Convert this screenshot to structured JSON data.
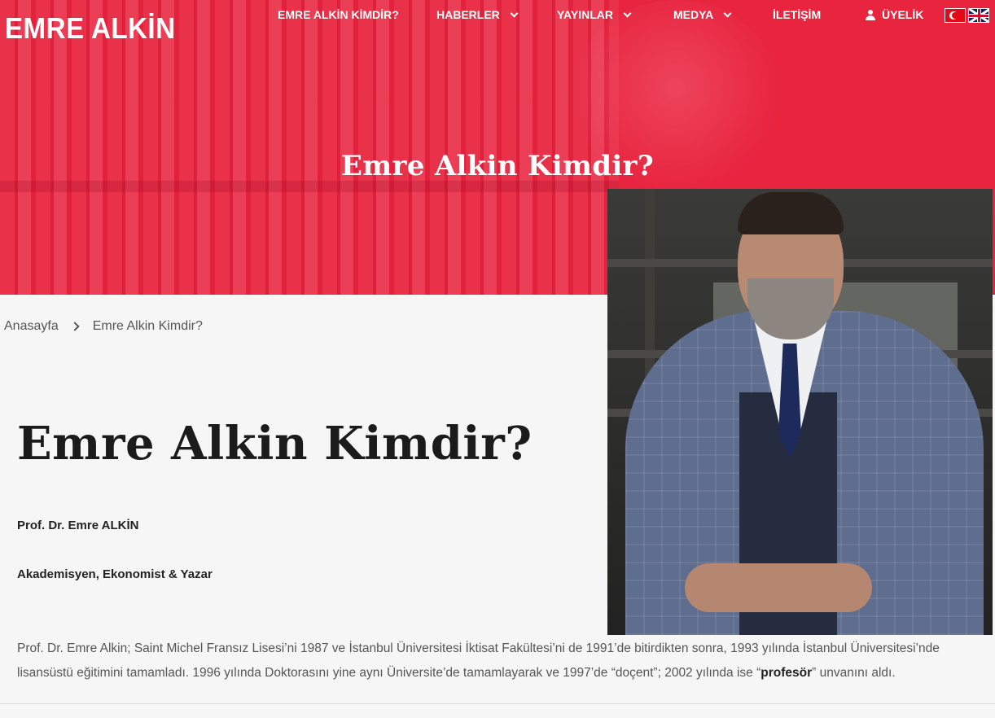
{
  "header": {
    "logo": "EMRE ALKİN",
    "nav": [
      {
        "label": "EMRE ALKİN KİMDİR?",
        "has_dropdown": false
      },
      {
        "label": "HABERLER",
        "has_dropdown": true
      },
      {
        "label": "YAYINLAR",
        "has_dropdown": true
      },
      {
        "label": "MEDYA",
        "has_dropdown": true
      },
      {
        "label": "İLETİŞİM",
        "has_dropdown": false
      },
      {
        "label": "ÜYELİK",
        "icon": "user-icon",
        "has_dropdown": false
      }
    ],
    "languages": [
      "tr-flag-icon",
      "uk-flag-icon"
    ]
  },
  "hero": {
    "title": "Emre Alkin Kimdir?",
    "background_color": "#e8243f"
  },
  "breadcrumb": {
    "home": "Anasayfa",
    "current": "Emre Alkin Kimdir?"
  },
  "main": {
    "title": "Emre Alkin Kimdir?",
    "subtitle_name": "Prof. Dr. Emre ALKİN",
    "subtitle_role": "Akademisyen, Ekonomist & Yazar",
    "bio_before": "Prof. Dr. Emre Alkin; Saint Michel Fransız Lisesi’ni 1987 ve İstanbul Üniversitesi İktisat Fakültesi’ni de 1991’de bitirdikten sonra, 1993 yılında İstanbul Üniversitesi’nde lisansüstü eğitimini tamamladı. 1996 yılında Doktorasını yine aynı Üniversite’de tamamlayarak ve 1997’de “doçent”; 2002 yılında ise “",
    "bio_bold": "profesör",
    "bio_after": "” unvanını aldı."
  }
}
